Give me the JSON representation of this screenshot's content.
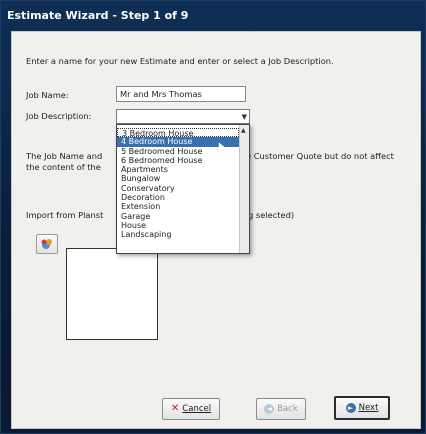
{
  "window": {
    "title": "Estimate Wizard - Step 1 of 9"
  },
  "intro_text": "Enter a name for your new Estimate and enter or select a Job Description.",
  "job_name": {
    "label": "Job Name:",
    "value": "Mr and Mrs Thomas"
  },
  "job_description": {
    "label": "Job Description:",
    "selected": "",
    "options": [
      "3 Bedroom House",
      "4 Bedroom House",
      "5 Bedroomed House",
      "6 Bedroomed House",
      "Apartments",
      "Bungalow",
      "Conservatory",
      "Decoration",
      "Extension",
      "Garage",
      "House",
      "Landscaping"
    ],
    "highlighted_index": 1
  },
  "note": {
    "line1_start": "The Job Name and",
    "line1_end": "e Customer Quote but do not affect",
    "line2_start": "the content of the"
  },
  "import": {
    "label_start": "Import from Planst",
    "label_end": "g selected)"
  },
  "buttons": {
    "cancel": "Cancel",
    "back": "Back",
    "next": "Next"
  },
  "icons": {
    "cancel": "x-icon",
    "back": "arrow-left-icon",
    "next": "arrow-right-icon",
    "import": "import-icon"
  }
}
